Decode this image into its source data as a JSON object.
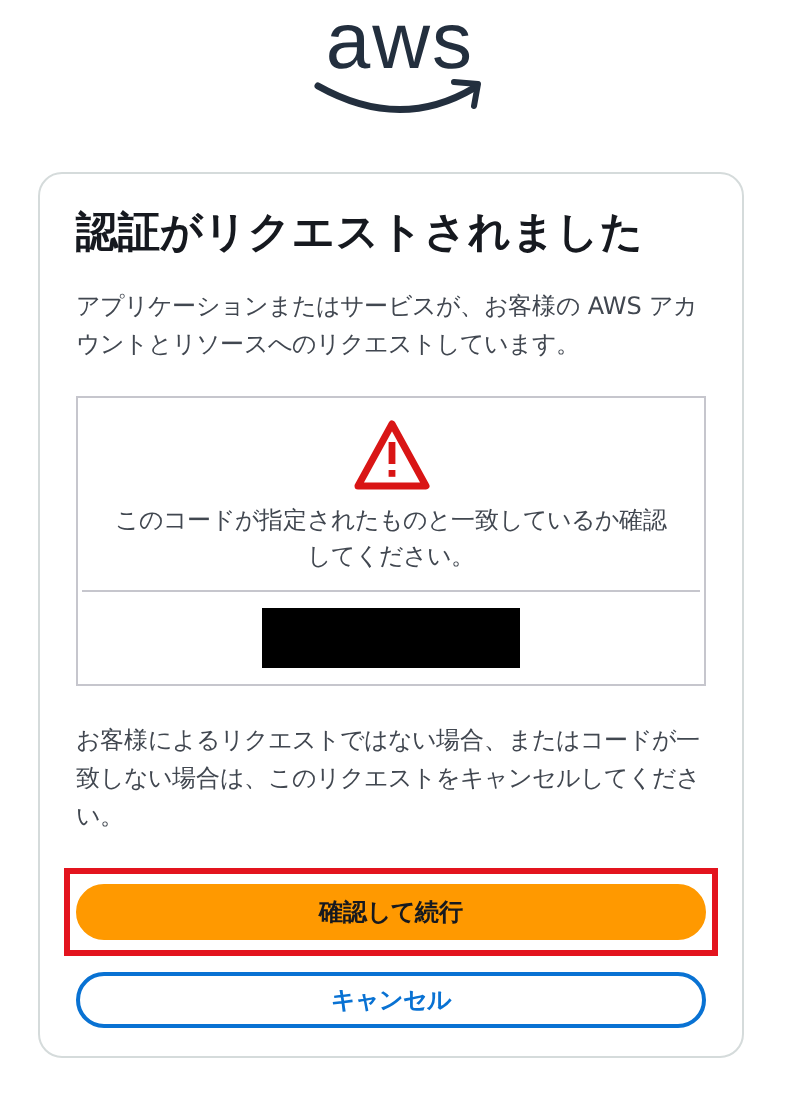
{
  "logo": {
    "text": "aws"
  },
  "card": {
    "title": "認証がリクエストされました",
    "description": "アプリケーションまたはサービスが、お客様の AWS アカウントとリソースへのリクエストしています。",
    "code_panel": {
      "message": "このコードが指定されたものと一致しているか確認してください。",
      "code_redacted": true
    },
    "warning": "お客様によるリクエストではない場合、またはコードが一致しない場合は、このリクエストをキャンセルしてください。",
    "buttons": [
      {
        "label": "確認して続行",
        "kind": "primary",
        "highlighted": true
      },
      {
        "label": "キャンセル",
        "kind": "outline",
        "highlighted": false
      }
    ]
  }
}
